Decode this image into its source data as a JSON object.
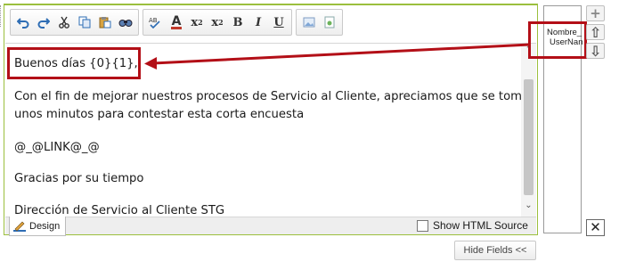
{
  "toolbar": {
    "groups": [
      [
        "undo-icon",
        "redo-icon",
        "cut-icon",
        "copy-icon",
        "paste-icon",
        "find-icon"
      ],
      [
        "spellcheck-icon",
        "font-color-icon",
        "subscript-icon",
        "superscript-icon",
        "bold-icon",
        "italic-icon",
        "underline-icon"
      ],
      [
        "image-icon",
        "media-icon"
      ]
    ],
    "font_color_glyph": "A",
    "subscript_glyph": "x",
    "subscript_mark": "2",
    "superscript_glyph": "x",
    "superscript_mark": "2",
    "bold_glyph": "B",
    "italic_glyph": "I",
    "underline_glyph": "U"
  },
  "content": {
    "greeting": "Buenos días {0}{1},",
    "paragraph_line1": "Con el fin de mejorar nuestros procesos de Servicio al Cliente, apreciamos que se tome",
    "paragraph_line2": "unos minutos para contestar esta corta encuesta",
    "link_placeholder": "@_@LINK@_@",
    "thanks": "Gracias por su tiempo",
    "signature": "Dirección de Servicio al Cliente STG"
  },
  "bottom_bar": {
    "design_tab": "Design",
    "show_html_label": "Show HTML Source",
    "show_html_checked": false
  },
  "fields": [
    "Nombre_",
    "UserNan"
  ],
  "side_buttons": {
    "add": "+",
    "up": "⇧",
    "down": "⇩",
    "close": "✕"
  },
  "hide_fields_button": "Hide Fields <<",
  "colors": {
    "accent_border": "#9bbf3d",
    "highlight": "#b30f17"
  }
}
